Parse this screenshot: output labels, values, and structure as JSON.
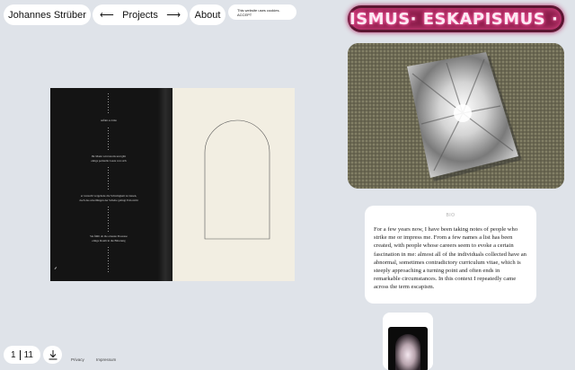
{
  "header": {
    "site_name": "Johannes Strüber",
    "projects_label": "Projects",
    "arrow_left": "⟵",
    "arrow_right": "⟶",
    "about_label": "About",
    "cookie_text": "This website uses cookies.",
    "cookie_accept": "ACCEPT"
  },
  "neon": {
    "text": "ISMUS· ESKAPISMUS ·",
    "color": "#fde9f3"
  },
  "spread": {
    "left_lines": [
      "anfänt es bitte",
      "Ihr Mann wird streits und gibt",
      "einige pointelle Laute von sich",
      "er versucht vergebens die Schwingkeit zu lassen,",
      "doch das unwillingen der Schelte gelingt Erin nicht",
      "Sie fühlt ob die erneute Prozesse",
      "einige Routh in die Bitterung"
    ]
  },
  "bio": {
    "title": "BIO",
    "text": "For a few years now, I have been taking notes of people who strike me or impress me. From a few names a list has been created, with people whose careers seem to evoke a certain fascination in me: almost all of the individuals collected have an abnormal, sometimes contradictory curriculum vitae, which is steeply approaching a turning point and often ends in remarkable circumstances. In this context I repeatedly came across the term escapism."
  },
  "pager": {
    "current": "1",
    "total": "11"
  },
  "footer": {
    "privacy": "Privacy",
    "impressum": "Impressum"
  },
  "colors": {
    "background": "#dfe3e9",
    "neon_frame": "#5b1631",
    "page_dark": "#141414",
    "page_light": "#f2eee2"
  }
}
